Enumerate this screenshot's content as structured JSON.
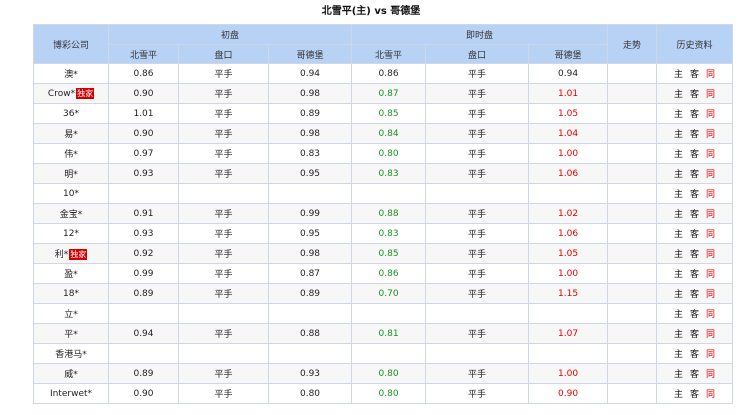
{
  "page": {
    "title": "北雪平(主) vs 哥德堡"
  },
  "header": {
    "company": "博彩公司",
    "initial": "初盘",
    "live": "即时盘",
    "trend": "走势",
    "history": "历史资料",
    "sub": {
      "home": "北雪平",
      "handicap": "盘口",
      "away": "哥德堡"
    }
  },
  "rows": [
    {
      "company": "澳*",
      "badge": "",
      "init_home": "0.86",
      "init_hcp": "平手",
      "init_away": "0.94",
      "live_home": "0.86",
      "live_home_color": "black",
      "live_hcp": "平手",
      "live_away": "0.94",
      "live_away_color": "black"
    },
    {
      "company": "Crow*",
      "badge": "独家",
      "init_home": "0.90",
      "init_hcp": "平手",
      "init_away": "0.98",
      "live_home": "0.87",
      "live_home_color": "green",
      "live_hcp": "平手",
      "live_away": "1.01",
      "live_away_color": "red"
    },
    {
      "company": "36*",
      "badge": "",
      "init_home": "1.01",
      "init_hcp": "平手",
      "init_away": "0.89",
      "live_home": "0.85",
      "live_home_color": "green",
      "live_hcp": "平手",
      "live_away": "1.05",
      "live_away_color": "red"
    },
    {
      "company": "易*",
      "badge": "",
      "init_home": "0.90",
      "init_hcp": "平手",
      "init_away": "0.98",
      "live_home": "0.84",
      "live_home_color": "green",
      "live_hcp": "平手",
      "live_away": "1.04",
      "live_away_color": "red"
    },
    {
      "company": "伟*",
      "badge": "",
      "init_home": "0.97",
      "init_hcp": "平手",
      "init_away": "0.83",
      "live_home": "0.80",
      "live_home_color": "green",
      "live_hcp": "平手",
      "live_away": "1.00",
      "live_away_color": "red"
    },
    {
      "company": "明*",
      "badge": "",
      "init_home": "0.93",
      "init_hcp": "平手",
      "init_away": "0.95",
      "live_home": "0.83",
      "live_home_color": "green",
      "live_hcp": "平手",
      "live_away": "1.06",
      "live_away_color": "red"
    },
    {
      "company": "10*",
      "badge": "",
      "init_home": "",
      "init_hcp": "",
      "init_away": "",
      "live_home": "",
      "live_home_color": "black",
      "live_hcp": "",
      "live_away": "",
      "live_away_color": "black"
    },
    {
      "company": "金宝*",
      "badge": "",
      "init_home": "0.91",
      "init_hcp": "平手",
      "init_away": "0.99",
      "live_home": "0.88",
      "live_home_color": "green",
      "live_hcp": "平手",
      "live_away": "1.02",
      "live_away_color": "red"
    },
    {
      "company": "12*",
      "badge": "",
      "init_home": "0.93",
      "init_hcp": "平手",
      "init_away": "0.95",
      "live_home": "0.83",
      "live_home_color": "green",
      "live_hcp": "平手",
      "live_away": "1.06",
      "live_away_color": "red"
    },
    {
      "company": "利*",
      "badge": "独家",
      "init_home": "0.92",
      "init_hcp": "平手",
      "init_away": "0.98",
      "live_home": "0.85",
      "live_home_color": "green",
      "live_hcp": "平手",
      "live_away": "1.05",
      "live_away_color": "red"
    },
    {
      "company": "盈*",
      "badge": "",
      "init_home": "0.99",
      "init_hcp": "平手",
      "init_away": "0.87",
      "live_home": "0.86",
      "live_home_color": "green",
      "live_hcp": "平手",
      "live_away": "1.00",
      "live_away_color": "red"
    },
    {
      "company": "18*",
      "badge": "",
      "init_home": "0.89",
      "init_hcp": "平手",
      "init_away": "0.89",
      "live_home": "0.70",
      "live_home_color": "green",
      "live_hcp": "平手",
      "live_away": "1.15",
      "live_away_color": "red"
    },
    {
      "company": "立*",
      "badge": "",
      "init_home": "",
      "init_hcp": "",
      "init_away": "",
      "live_home": "",
      "live_home_color": "black",
      "live_hcp": "",
      "live_away": "",
      "live_away_color": "black"
    },
    {
      "company": "平*",
      "badge": "",
      "init_home": "0.94",
      "init_hcp": "平手",
      "init_away": "0.88",
      "live_home": "0.81",
      "live_home_color": "green",
      "live_hcp": "平手",
      "live_away": "1.07",
      "live_away_color": "red"
    },
    {
      "company": "香港马*",
      "badge": "",
      "init_home": "",
      "init_hcp": "",
      "init_away": "",
      "live_home": "",
      "live_home_color": "black",
      "live_hcp": "",
      "live_away": "",
      "live_away_color": "black"
    },
    {
      "company": "威*",
      "badge": "",
      "init_home": "0.89",
      "init_hcp": "平手",
      "init_away": "0.93",
      "live_home": "0.80",
      "live_home_color": "green",
      "live_hcp": "平手",
      "live_away": "1.00",
      "live_away_color": "red"
    },
    {
      "company": "Interwet*",
      "badge": "",
      "init_home": "0.90",
      "init_hcp": "平手",
      "init_away": "0.80",
      "live_home": "0.80",
      "live_home_color": "green",
      "live_hcp": "平手",
      "live_away": "0.90",
      "live_away_color": "red"
    }
  ],
  "links": {
    "home": "主",
    "away": "客",
    "same": "同"
  },
  "colors": {
    "header_bg": "#b7d2f5",
    "green": "#18921e",
    "red": "#e00000",
    "badge_bg": "#d40000",
    "border": "#cfd7e6"
  }
}
